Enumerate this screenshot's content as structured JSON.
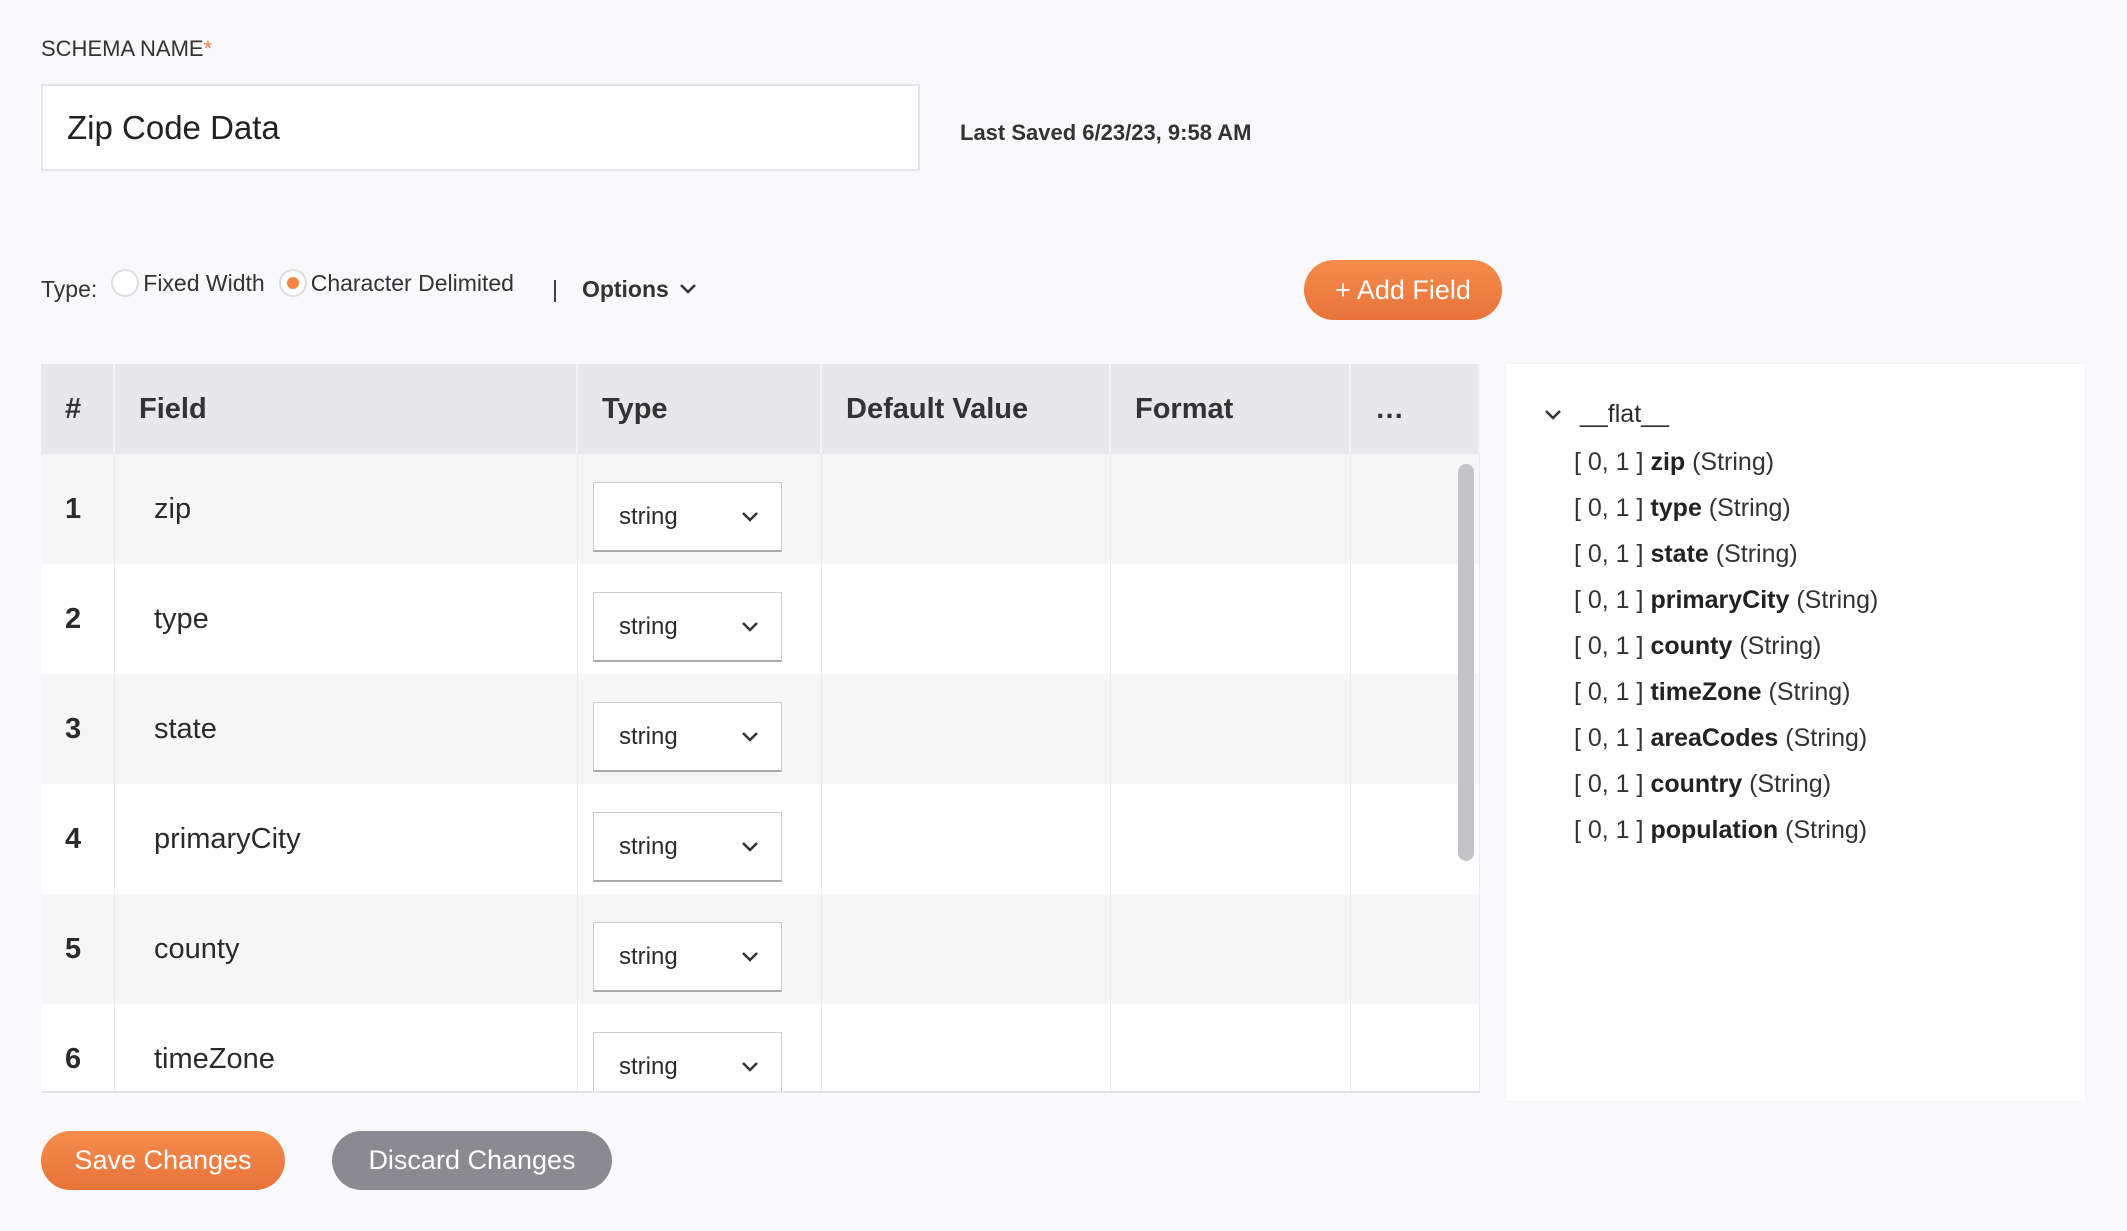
{
  "schema": {
    "label": "SCHEMA NAME",
    "required_mark": "*",
    "name_value": "Zip Code Data",
    "last_saved": "Last Saved 6/23/23, 9:58 AM"
  },
  "type_row": {
    "label": "Type:",
    "options": [
      {
        "label": "Fixed Width",
        "selected": false
      },
      {
        "label": "Character Delimited",
        "selected": true
      }
    ],
    "separator": "|",
    "options_menu": "Options"
  },
  "add_field": "+ Add Field",
  "table": {
    "headers": [
      "#",
      "Field",
      "Type",
      "Default Value",
      "Format",
      "…"
    ],
    "rows": [
      {
        "num": "1",
        "field": "zip",
        "type": "string"
      },
      {
        "num": "2",
        "field": "type",
        "type": "string"
      },
      {
        "num": "3",
        "field": "state",
        "type": "string"
      },
      {
        "num": "4",
        "field": "primaryCity",
        "type": "string"
      },
      {
        "num": "5",
        "field": "county",
        "type": "string"
      },
      {
        "num": "6",
        "field": "timeZone",
        "type": "string"
      }
    ]
  },
  "tree": {
    "root": "__flat__",
    "items": [
      {
        "card": "[ 0, 1 ]",
        "name": "zip",
        "type": "(String)"
      },
      {
        "card": "[ 0, 1 ]",
        "name": "type",
        "type": "(String)"
      },
      {
        "card": "[ 0, 1 ]",
        "name": "state",
        "type": "(String)"
      },
      {
        "card": "[ 0, 1 ]",
        "name": "primaryCity",
        "type": "(String)"
      },
      {
        "card": "[ 0, 1 ]",
        "name": "county",
        "type": "(String)"
      },
      {
        "card": "[ 0, 1 ]",
        "name": "timeZone",
        "type": "(String)"
      },
      {
        "card": "[ 0, 1 ]",
        "name": "areaCodes",
        "type": "(String)"
      },
      {
        "card": "[ 0, 1 ]",
        "name": "country",
        "type": "(String)"
      },
      {
        "card": "[ 0, 1 ]",
        "name": "population",
        "type": "(String)"
      }
    ]
  },
  "buttons": {
    "save": "Save Changes",
    "discard": "Discard Changes"
  },
  "colors": {
    "accent": "#f08545",
    "discard": "#8a8a90"
  }
}
